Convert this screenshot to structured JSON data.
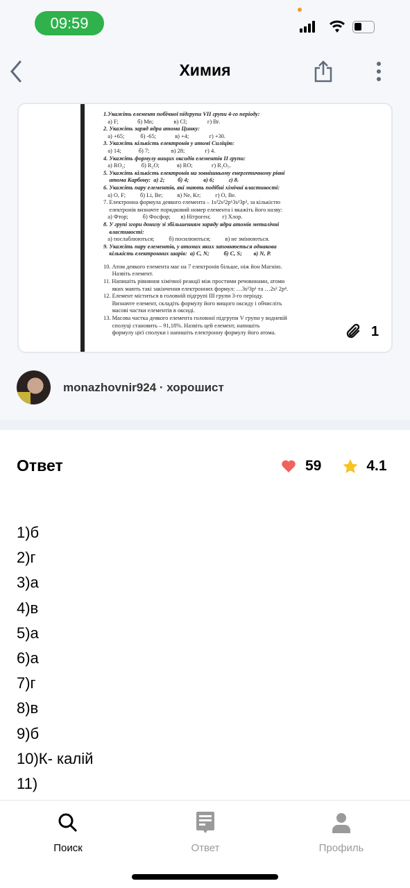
{
  "status_bar": {
    "time": "09:59"
  },
  "header": {
    "title": "Химия"
  },
  "question": {
    "lines": [
      {
        "t": "1.Укажіть елемент побічної підгрупи VII групи 4-го періоду:",
        "q": true
      },
      {
        "t": "   а) F;             б) Mn;              в) Cl;              г) Br.",
        "q": false
      },
      {
        "t": "2. Укажіть заряд ядра атома Цинку:",
        "q": true
      },
      {
        "t": "   а) +65;           б) -65;             в) +4;              г) +30.",
        "q": false
      },
      {
        "t": "3. Укажіть кількість електронів у атомі Силіцію:",
        "q": true
      },
      {
        "t": "   а) 14;            б) 7;               в) 28;              г) 4.",
        "q": false
      },
      {
        "t": "4. Укажіть формулу вищих оксидів елементів II групи:",
        "q": true
      },
      {
        "t": "   а) RO₂;           б) R₂O;            в) RO;             г) R₂O₅.",
        "q": false
      },
      {
        "t": "5. Укажіть кількість електронів на зовнішньому енергетичному рівні",
        "q": true
      },
      {
        "t": "    атома Карбону:  а) 2;         б) 4;          в) 6;          г) 8.",
        "q": true
      },
      {
        "t": "6. Укажіть пару елементів, які мають подібні хімічні властивості:",
        "q": true
      },
      {
        "t": "   а) O, F;          б) Li, Be;          в) Ne, Kr;          г) O, Be.",
        "q": false
      },
      {
        "t": "7. Електронна формула деякого елемента – 1s²2s²2p⁶3s²3p³, за кількістю",
        "q": false
      },
      {
        "t": "    електронів визначте порядковий номер елемента і вкажіть його назву:",
        "q": false
      },
      {
        "t": "   а) Фтор;          б) Фосфор;       в) Нітроген;        г) Хлор.",
        "q": false
      },
      {
        "t": "8. У групі згори донизу зі збільшенням заряду ядра атомів металічні",
        "q": true
      },
      {
        "t": "    властивості:",
        "q": true
      },
      {
        "t": "   а) послаблюються;          б) посилюються;          в) не змінюються.",
        "q": false
      },
      {
        "t": "9. Укажіть пару елементів, у атомах яких заповнюється однакова",
        "q": true
      },
      {
        "t": "    кількість електронних шарів:  а) C, N;          б) C, S;        в) N, P.",
        "q": true
      },
      {
        "t": "",
        "q": false
      },
      {
        "t": "10. Атом деякого елемента має на 7 електронів більше, ніж йон Магнію.",
        "q": false
      },
      {
        "t": "      Назвіть елемент.",
        "q": false
      },
      {
        "t": "11. Напишіть рівняння хімічної реакції між простими речовинами, атоми",
        "q": false
      },
      {
        "t": "      яких мають такі закінчення електронних формул: …3s²3p¹ та …2s² 2p⁴.",
        "q": false
      },
      {
        "t": "12. Елемент міститься в головній підгрупі III групи 3-го періоду.",
        "q": false
      },
      {
        "t": "      Визначте елемент, складіть формулу його вищого оксиду і обчисліть",
        "q": false
      },
      {
        "t": "      масові частки елементів в оксиді.",
        "q": false
      },
      {
        "t": "13. Масова частка деякого елемента головної підгрупи V групи у водневій",
        "q": false
      },
      {
        "t": "      сполуці становить – 91,18%. Назвіть цей елемент, напишіть",
        "q": false
      },
      {
        "t": "      формулу цієї сполуки і напишіть електронну формулу його атома.",
        "q": false
      }
    ],
    "attachments_count": "1"
  },
  "author": {
    "name": "monazhovnir924 · хорошист"
  },
  "answer": {
    "heading": "Ответ",
    "likes": "59",
    "rating": "4.1",
    "heart_color": "#f0635c",
    "star_color": "#f7c325",
    "lines": [
      "1)б",
      "2)г",
      "3)а",
      "4)в",
      "5)а",
      "6)а",
      "7)г",
      "8)в",
      "9)б",
      "10)К- калій",
      "11)"
    ]
  },
  "nav": {
    "tabs": [
      {
        "label": "Поиск",
        "active": true
      },
      {
        "label": "Ответ"
      },
      {
        "label": "Профиль"
      }
    ]
  }
}
